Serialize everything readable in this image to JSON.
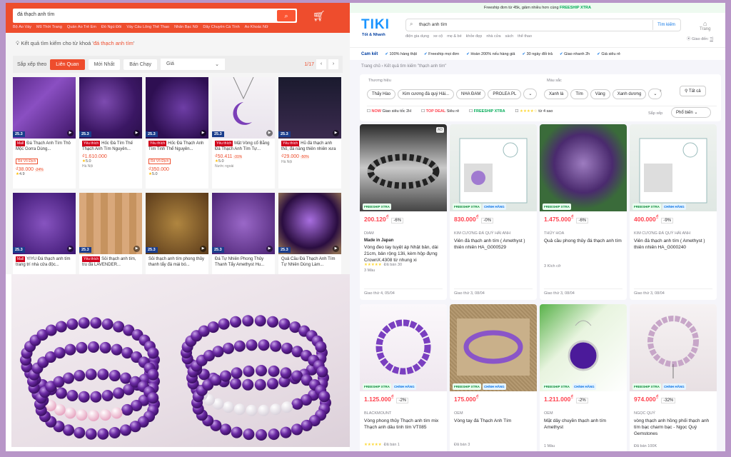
{
  "shopee": {
    "search_value": "đá thạch anh tím",
    "suggestions": [
      "Bộ Áo Váy",
      "Mũ Thời Trang",
      "Quần Áo Trẻ Em",
      "Đồ Ngủ Đôi",
      "Váy Cầu Lông Thể Thao",
      "Nhẫn Bạc Nữ",
      "Dây Chuyền Cá Tính",
      "Áo Khoác Nữ"
    ],
    "result_prefix": "Kết quả tìm kiếm cho từ khoá '",
    "result_keyword": "đá thạch anh tím",
    "result_suffix": "'",
    "sort_label": "Sắp xếp theo",
    "sort_options": [
      "Liên Quan",
      "Mới Nhất",
      "Bán Chạy"
    ],
    "price_label": "Giá",
    "page": "1/17",
    "products": [
      {
        "name": "Đá Thạch Anh Tím Thô Mộc Gorra Dùng...",
        "price": "₫38.000",
        "discount": "-24%",
        "tag": "Rẻ Vô Địch",
        "rating": "4.9",
        "loc": "",
        "badge": "25.3",
        "mall": "Mall"
      },
      {
        "name": "Hốc Đá Tím Thế Thạch Anh Tím Nguyên...",
        "price": "₫1.610.000",
        "discount": "",
        "tag": "",
        "rating": "5.0",
        "loc": "Hà Nội",
        "badge": "25.3",
        "mall": "Yêu thích"
      },
      {
        "name": "Hốc Đá Thạch Anh Tím Tinh Thể Nguyên...",
        "price": "₫350.000",
        "discount": "",
        "tag": "Rẻ Vô Địch",
        "rating": "5.0",
        "loc": "",
        "badge": "25.3",
        "mall": "Yêu thích"
      },
      {
        "name": "Mặt Vòng cổ Bằng Đá Thạch Anh Tím Tự...",
        "price": "₫50.411",
        "discount": "-31%",
        "tag": "",
        "rating": "5.0",
        "loc": "Nước ngoài",
        "badge": "25.3",
        "mall": "Yêu thích"
      },
      {
        "name": "Hũ đá thạch anh thô, đá năng thiên nhiên xưa tả...",
        "price": "₫29.000",
        "discount": "-50%",
        "tag": "",
        "rating": "",
        "loc": "Hà Nội",
        "badge": "25.3",
        "mall": "Yêu thích"
      },
      {
        "name": "YIYU Đá thạch anh tím trang trí nhà cửa độc...",
        "price": "",
        "discount": "",
        "tag": "",
        "rating": "",
        "loc": "",
        "badge": "25.3",
        "mall": "Mall"
      },
      {
        "name": "Sỏi thạch anh tím, tru đá LAVENDER...",
        "price": "",
        "discount": "",
        "tag": "",
        "rating": "",
        "loc": "",
        "badge": "25.3",
        "mall": "Yêu thích"
      },
      {
        "name": "Sỏi thạch anh tím phong thủy thanh tẩy đá mài bó...",
        "price": "",
        "discount": "",
        "tag": "",
        "rating": "",
        "loc": "",
        "badge": "25.3",
        "mall": ""
      },
      {
        "name": "Đá Tự Nhiên Phong Thủy Thanh Tẩy Amethyst Hu...",
        "price": "",
        "discount": "",
        "tag": "",
        "rating": "",
        "loc": "",
        "badge": "25.3",
        "mall": ""
      },
      {
        "name": "Quả Cầu Đá Thạch Anh Tím Tự Nhiên Dùng Làm...",
        "price": "",
        "discount": "",
        "tag": "",
        "rating": "",
        "loc": "",
        "badge": "25.3",
        "mall": ""
      }
    ]
  },
  "tiki": {
    "topbar_text": "Freeship đơn từ 45k, giảm nhiều hơn cùng ",
    "topbar_brand": "FREESHIP XTRA",
    "logo": "TIKI",
    "slogan": "Tốt & Nhanh",
    "search_value": "thạch anh tím",
    "search_button": "Tìm kiếm",
    "home_label": "Trang",
    "keywords": [
      "điện gia dụng",
      "xe cộ",
      "mẹ & bé",
      "khỏe đẹp",
      "nhà cửa",
      "sách",
      "thể thao"
    ],
    "ship_label": "Giao đến: ",
    "ship_value": "Tỉ",
    "commit_label": "Cam kết",
    "commits": [
      "100% hàng thật",
      "Freeship mọi đơn",
      "Hoàn 200% nếu hàng giả",
      "30 ngày đổi trả",
      "Giao nhanh 2h",
      "Giá siêu rẻ"
    ],
    "breadcrumb": "Trang chủ  ›  Kết quả tìm kiếm \"thạch anh tím\"",
    "filter_brand_label": "Thương hiệu",
    "brands": [
      "Thấy Hào",
      "Kim cương đá quý Hải...",
      "NHA ĐAM",
      "PROLEA PL"
    ],
    "filter_color_label": "Màu sắc",
    "colors": [
      "Xanh lá",
      "Tím",
      "Vàng",
      "Xanh dương"
    ],
    "filter_all": "Tất cả",
    "opt_now": "NOW",
    "opt_now_text": "Giao siêu tốc 2H",
    "opt_topdeal": "TOP DEAL",
    "opt_topdeal_text": "Siêu rẻ",
    "opt_xtra": "FREESHIP XTRA",
    "opt_stars": "từ 4 sao",
    "sort_label": "Sắp xếp",
    "sort_value": "Phổ biến",
    "products": [
      {
        "price": "200.120",
        "discount": "-6%",
        "brand": "DIAM",
        "name": "Made in Japan",
        "name2": "Vòng đeo tay tuyệt áp Nhật bản, dài 21cm, bản rộng 13li, kèm hộp đựng CrownX.4308 từ nhung xi",
        "rating": "★★★★★",
        "sold": "Đã bán 30",
        "delivery": "Giao thứ 4, 05/04",
        "extra": "3 Màu",
        "ad": "AD"
      },
      {
        "price": "830.000",
        "discount": "-0%",
        "brand": "KIM CƯƠNG ĐÁ QUÝ HẢI ANH",
        "name": "",
        "name2": "Viên đá thạch anh tím ( Amethyst ) thiên nhiên HA_G000529",
        "rating": "",
        "sold": "",
        "delivery": "Giao thứ 3, 08/04",
        "extra": "",
        "ad": ""
      },
      {
        "price": "1.475.000",
        "discount": "-6%",
        "brand": "THỦY HOA",
        "name": "",
        "name2": "Quả cầu phong thủy đá thạch anh tím",
        "rating": "",
        "sold": "",
        "delivery": "Giao thứ 3, 08/04",
        "extra": "3 Kích cỡ",
        "ad": ""
      },
      {
        "price": "400.000",
        "discount": "-9%",
        "brand": "KIM CƯƠNG ĐÁ QUÝ HẢI ANH",
        "name": "",
        "name2": "Viên đá thạch anh tím ( Amethyst ) thiên nhiên HA_G000240",
        "rating": "",
        "sold": "",
        "delivery": "Giao thứ 3, 08/04",
        "extra": "",
        "ad": ""
      },
      {
        "price": "1.125.000",
        "discount": "-2%",
        "brand": "BLACKMOUNT",
        "name": "",
        "name2": "Vòng phong thủy Thạch anh tím mix Thạch anh dâu tinh tím VT085",
        "rating": "★★★★★",
        "sold": "Đã bán 1",
        "delivery": "",
        "extra": "",
        "ad": ""
      },
      {
        "price": "175.000",
        "discount": "",
        "brand": "OEM",
        "name": "",
        "name2": "Vòng tay đá Thạch Anh Tím",
        "rating": "",
        "sold": "Đã bán 3",
        "delivery": "",
        "extra": "",
        "ad": ""
      },
      {
        "price": "1.211.000",
        "discount": "-2%",
        "brand": "OEM",
        "name": "",
        "name2": "Mặt dây chuyền thạch anh tím Amethyst",
        "rating": "",
        "sold": "",
        "delivery": "",
        "extra": "1 Màu",
        "ad": ""
      },
      {
        "price": "974.000",
        "discount": "-32%",
        "brand": "NGỌC QUÝ",
        "name": "",
        "name2": "vòng thạch anh hồng phối thạch anh tím bạc charm bạc - Ngọc Quý Gemstones",
        "rating": "",
        "sold": "",
        "delivery": "",
        "extra": "Đã bán 100K",
        "ad": ""
      }
    ],
    "currency": "₫",
    "xtra_label": "FREESHIP XTRA",
    "chinh_hang": "CHÍNH HÃNG"
  }
}
